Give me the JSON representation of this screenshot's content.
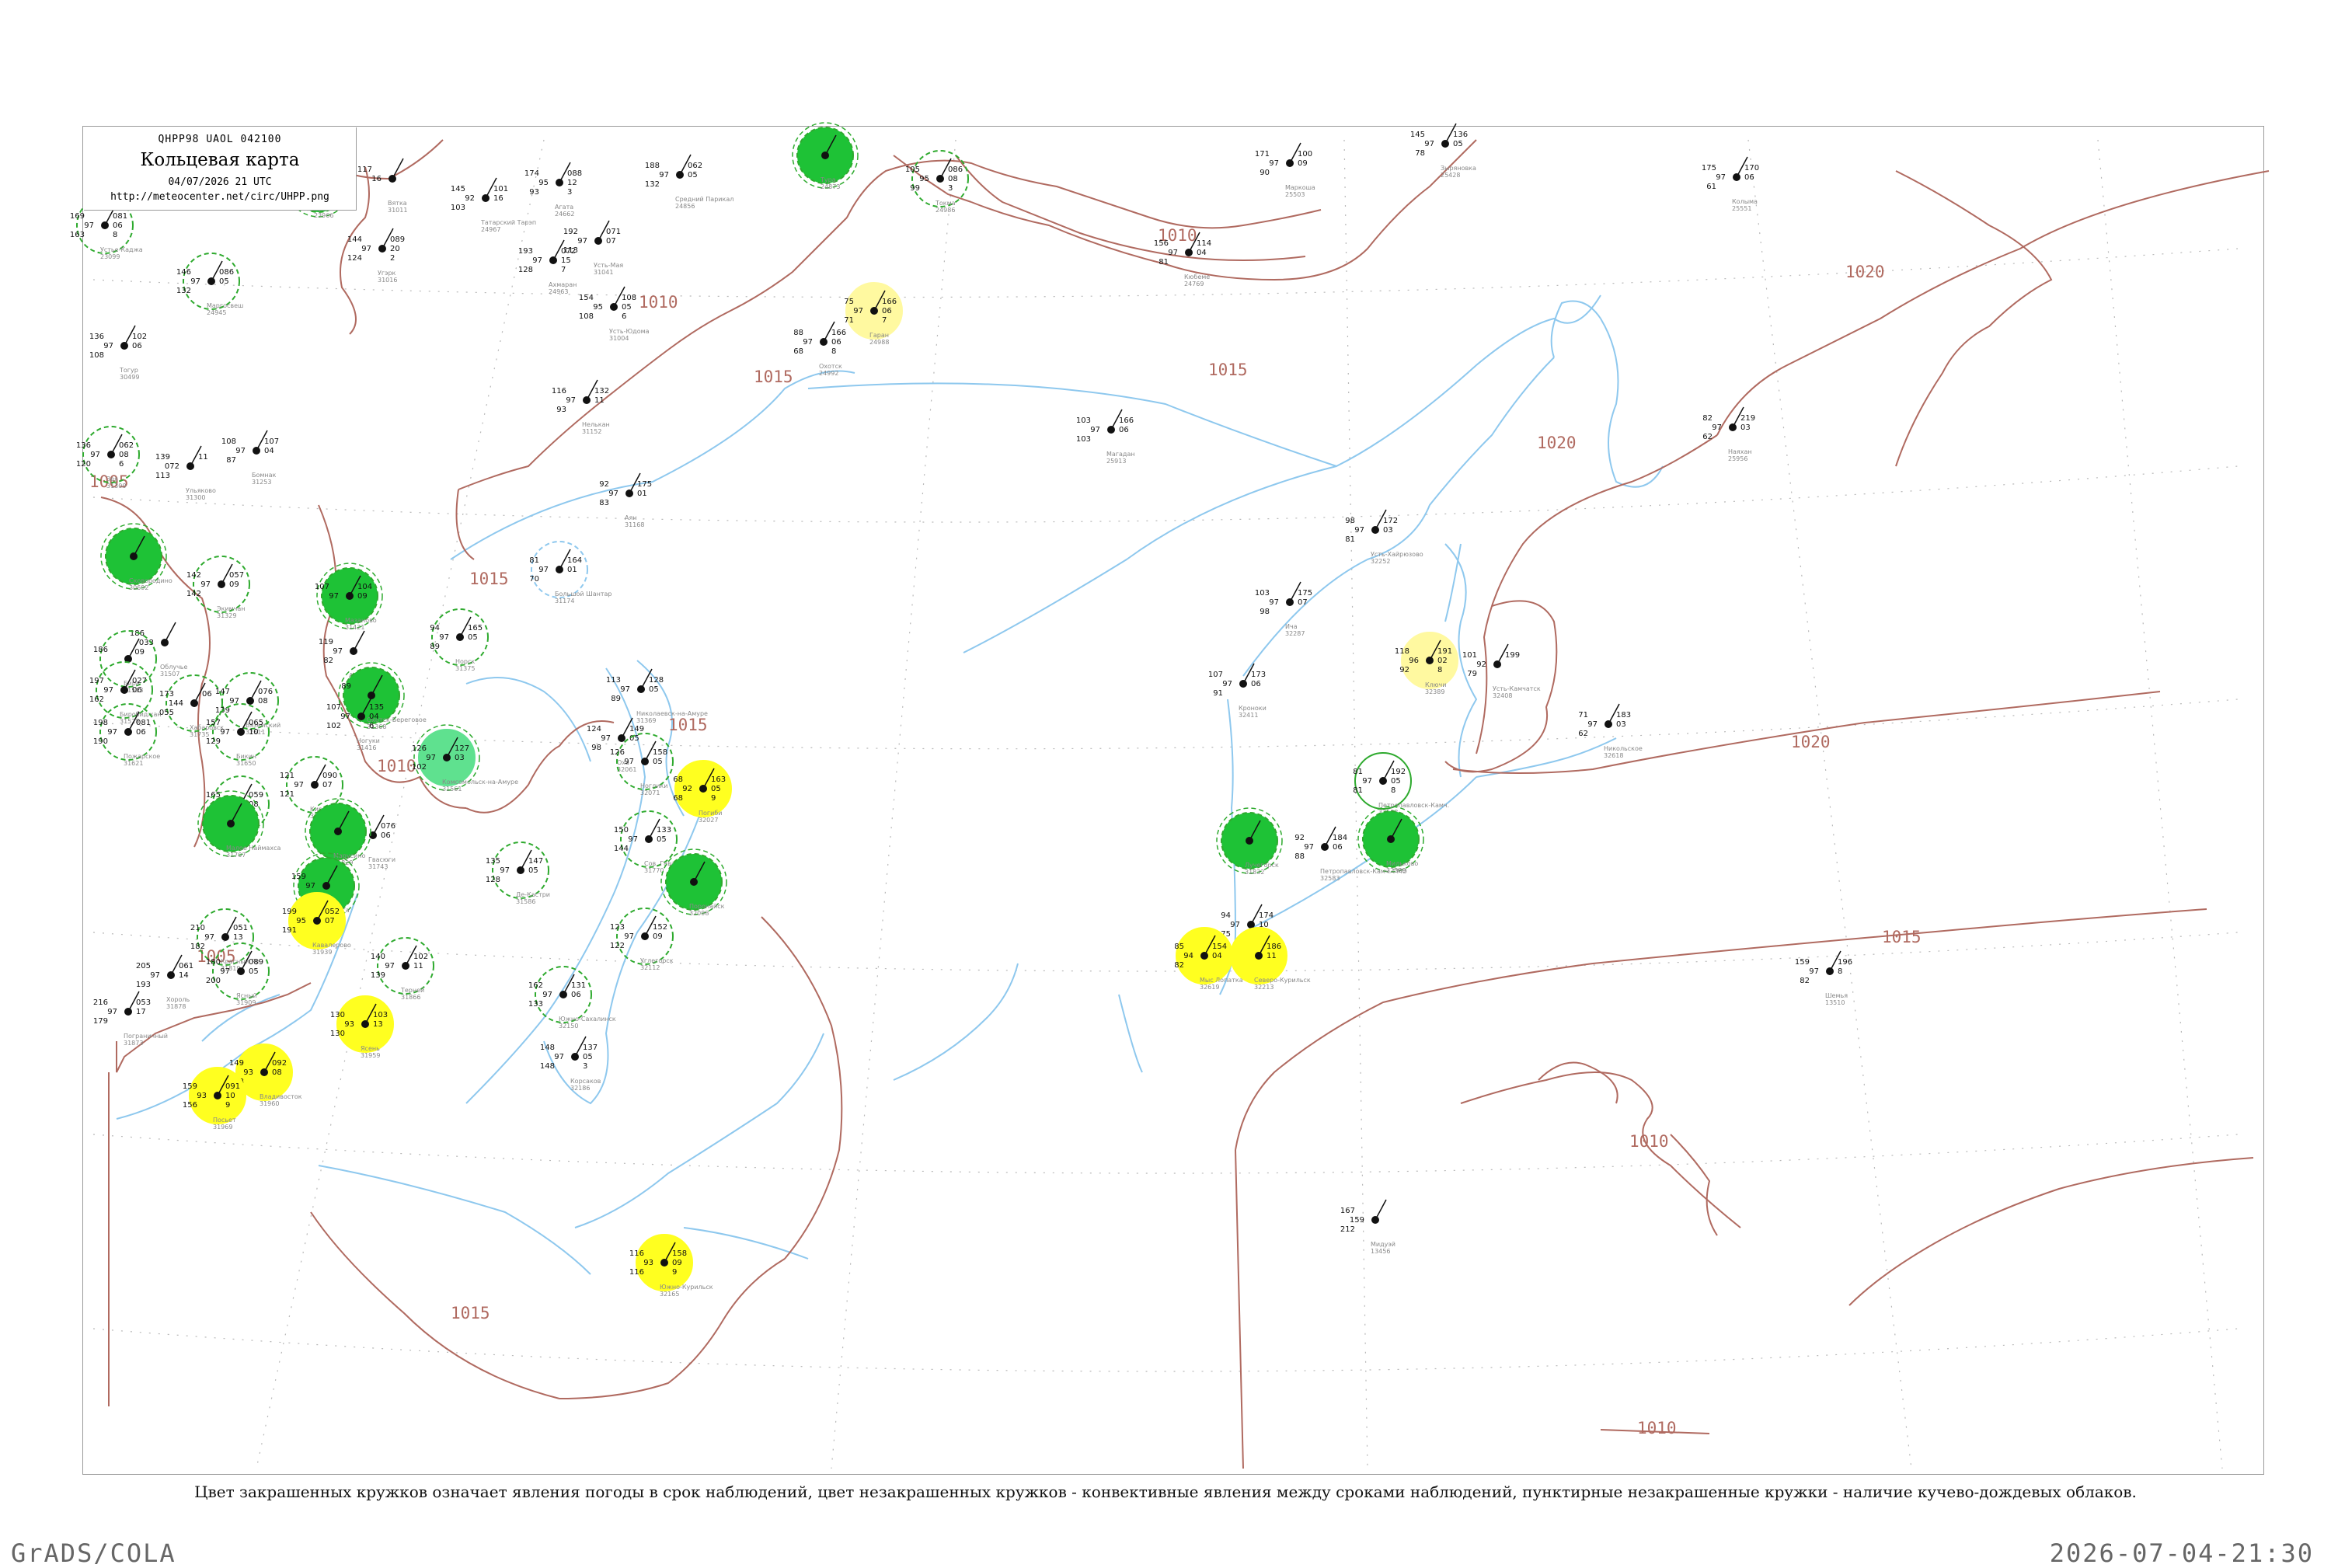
{
  "header": {
    "code": "QHPP98  UAOL  042100",
    "title": "Кольцевая карта",
    "datetime": "04/07/2026 21 UTC",
    "url": "http://meteocenter.net/circ/UHPP.png"
  },
  "caption": "Цвет закрашенных кружков означает явления погоды в срок наблюдений, цвет незакрашенных кружков - конвективные явления между сроками наблюдений, пунктирные незакрашенные кружки - наличие кучево-дождевых облаков.",
  "footer": {
    "left": "GrADS/COLA",
    "right": "2026-07-04-21:30"
  },
  "colors": {
    "isobar": "#b06a60",
    "coast": "#8ec8ee",
    "green_fill": "#1ec236",
    "light_green_fill": "#5fe18f",
    "yellow_fill": "#ffff20",
    "pale_yellow_fill": "#fff9a0",
    "ring": "#2eaa2e"
  },
  "isobar_labels": [
    "1010",
    "1015",
    "1015",
    "1010",
    "1015",
    "1015",
    "1010",
    "1005",
    "1005",
    "1015",
    "1020",
    "1020",
    "1020",
    "1015",
    "1010",
    "1010"
  ],
  "stations": [
    {
      "name": "Устье-Каджа",
      "num": "23099",
      "v": [
        "169",
        "97",
        "163",
        "081",
        "06",
        "8"
      ],
      "circle": "dashed"
    },
    {
      "name": "Бузин",
      "num": "23966",
      "v": [
        "179",
        "99",
        "126",
        "03",
        ""
      ],
      "circle": "green"
    },
    {
      "name": "Вятка",
      "num": "31011",
      "v": [
        "117",
        "16",
        "",
        ""
      ],
      "circle": "none"
    },
    {
      "name": "Татарский Тарэп",
      "num": "24967",
      "v": [
        "145",
        "92",
        "103",
        "101",
        "16"
      ],
      "circle": "none"
    },
    {
      "name": "Агата",
      "num": "24662",
      "v": [
        "174",
        "95",
        "93",
        "088",
        "12",
        "3"
      ],
      "circle": "none"
    },
    {
      "name": "Средний Парикал",
      "num": "24856",
      "v": [
        "188",
        "97",
        "132",
        "062",
        "05",
        ""
      ],
      "circle": "none"
    },
    {
      "name": "Тура",
      "num": "24873",
      "v": [
        "",
        "",
        ""
      ],
      "circle": "green"
    },
    {
      "name": "Токма",
      "num": "24986",
      "v": [
        "105",
        "95",
        "99",
        "086",
        "08",
        "3"
      ],
      "circle": "dashed"
    },
    {
      "name": "Маркоша",
      "num": "25503",
      "v": [
        "171",
        "97",
        "90",
        "100",
        "09",
        ""
      ],
      "circle": "none"
    },
    {
      "name": "Зыряновка",
      "num": "25428",
      "v": [
        "145",
        "97",
        "78",
        "136",
        "05",
        ""
      ],
      "circle": "none"
    },
    {
      "name": "Колыма",
      "num": "25551",
      "v": [
        "175",
        "97",
        "61",
        "170",
        "06",
        ""
      ],
      "circle": "none"
    },
    {
      "name": "Угэрк",
      "num": "31016",
      "v": [
        "144",
        "97",
        "124",
        "089",
        "20",
        "2"
      ],
      "circle": "none"
    },
    {
      "name": "Усть-Мая",
      "num": "31041",
      "v": [
        "192",
        "97",
        "113",
        "071",
        "07",
        ""
      ],
      "circle": "none"
    },
    {
      "name": "Ахмаран",
      "num": "24963",
      "v": [
        "193",
        "97",
        "128",
        "072",
        "15",
        "7"
      ],
      "circle": "none"
    },
    {
      "name": "Усть-Юдома",
      "num": "31004",
      "v": [
        "154",
        "95",
        "108",
        "108",
        "05",
        "6"
      ],
      "circle": "none"
    },
    {
      "name": "Маргосвеш",
      "num": "24945",
      "v": [
        "146",
        "97",
        "132",
        "086",
        "05",
        ""
      ],
      "circle": "dashed"
    },
    {
      "name": "Кюбеме",
      "num": "24769",
      "v": [
        "156",
        "97",
        "81",
        "114",
        "04",
        ""
      ],
      "circle": "none"
    },
    {
      "name": "Гаран",
      "num": "24988",
      "v": [
        "75",
        "97",
        "71",
        "166",
        "06",
        "7"
      ],
      "circle": "paleyellow"
    },
    {
      "name": "Охотск",
      "num": "24992",
      "v": [
        "88",
        "97",
        "68",
        "166",
        "06",
        "8"
      ],
      "circle": "none"
    },
    {
      "name": "Тогур",
      "num": "30499",
      "v": [
        "136",
        "97",
        "108",
        "102",
        "06",
        ""
      ],
      "circle": "none"
    },
    {
      "name": "Нелькан",
      "num": "31152",
      "v": [
        "116",
        "97",
        "93",
        "132",
        "11",
        ""
      ],
      "circle": "none"
    },
    {
      "name": "Зея",
      "num": "31300",
      "v": [
        "136",
        "97",
        "120",
        "062",
        "08",
        "6"
      ],
      "circle": "dashed"
    },
    {
      "name": "Бомнак",
      "num": "31253",
      "v": [
        "108",
        "97",
        "87",
        "107",
        "04",
        ""
      ],
      "circle": "none"
    },
    {
      "name": "Ульяково",
      "num": "31300",
      "v": [
        "139",
        "072",
        "113",
        "11"
      ],
      "circle": "none"
    },
    {
      "name": "Магадан",
      "num": "25913",
      "v": [
        "103",
        "97",
        "103",
        "166",
        "06",
        ""
      ],
      "circle": "none"
    },
    {
      "name": "Наяхан",
      "num": "25956",
      "v": [
        "82",
        "97",
        "62",
        "219",
        "03",
        ""
      ],
      "circle": "none"
    },
    {
      "name": "Аян",
      "num": "31168",
      "v": [
        "92",
        "97",
        "83",
        "175",
        "01",
        ""
      ],
      "circle": "none"
    },
    {
      "name": "Сковородино",
      "num": "30692",
      "v": [
        "",
        "",
        ""
      ],
      "circle": "green"
    },
    {
      "name": "Экимчан",
      "num": "31329",
      "v": [
        "142",
        "97",
        "142",
        "057",
        "09",
        ""
      ],
      "circle": "dashed"
    },
    {
      "name": "Мазаново",
      "num": "31421",
      "v": [
        "107",
        "97",
        "",
        "104",
        "09",
        ""
      ],
      "circle": "green"
    },
    {
      "name": "Большой Шантар",
      "num": "31174",
      "v": [
        "81",
        "97",
        "70",
        "164",
        "01",
        ""
      ],
      "circle": "dashedblue"
    },
    {
      "name": "Усть-Хайрюзово",
      "num": "32252",
      "v": [
        "98",
        "97",
        "81",
        "172",
        "03",
        ""
      ],
      "circle": "none"
    },
    {
      "name": "Ича",
      "num": "32287",
      "v": [
        "103",
        "97",
        "98",
        "175",
        "07",
        ""
      ],
      "circle": "none"
    },
    {
      "name": "Ключи",
      "num": "32389",
      "v": [
        "118",
        "96",
        "92",
        "191",
        "02",
        "8"
      ],
      "circle": "paleyellow"
    },
    {
      "name": "Усть-Камчатск",
      "num": "32408",
      "v": [
        "101",
        "92",
        "79",
        "199",
        "",
        ""
      ],
      "circle": "none"
    },
    {
      "name": "Кроноки",
      "num": "32411",
      "v": [
        "107",
        "97",
        "91",
        "173",
        "06",
        ""
      ],
      "circle": "none"
    },
    {
      "name": "Никольское",
      "num": "32618",
      "v": [
        "71",
        "97",
        "62",
        "183",
        "03",
        ""
      ],
      "circle": "none"
    },
    {
      "name": "Архара",
      "num": "31445",
      "v": [
        "119",
        "97",
        "82",
        "",
        "",
        ""
      ],
      "circle": "none"
    },
    {
      "name": "Норск",
      "num": "31375",
      "v": [
        "94",
        "97",
        "89",
        "165",
        "05",
        ""
      ],
      "circle": "dashed"
    },
    {
      "name": "Охотск-Береговое",
      "num": "31368",
      "v": [
        "89",
        "",
        "",
        "",
        "",
        ""
      ],
      "circle": "green"
    },
    {
      "name": "Облучье",
      "num": "31507",
      "v": [
        "186",
        "033",
        "09",
        ""
      ],
      "circle": "none"
    },
    {
      "name": "Бира",
      "num": "31513",
      "v": [
        "186",
        "",
        "",
        ""
      ],
      "circle": "dashed"
    },
    {
      "name": "Биробиджан",
      "num": "31528",
      "v": [
        "197",
        "97",
        "162",
        "027",
        "06",
        ""
      ],
      "circle": "dashed"
    },
    {
      "name": "Хабаровск",
      "num": "31735",
      "v": [
        "173",
        "144",
        "055",
        "06"
      ],
      "circle": "dashed"
    },
    {
      "name": "Вяземский",
      "num": "31611",
      "v": [
        "147",
        "97",
        "139",
        "076",
        "08",
        ""
      ],
      "circle": "dashed"
    },
    {
      "name": "Пожарское",
      "num": "31621",
      "v": [
        "198",
        "97",
        "190",
        "081",
        "06",
        ""
      ],
      "circle": "dashed"
    },
    {
      "name": "Бикин",
      "num": "31650",
      "v": [
        "157",
        "97",
        "129",
        "065",
        "10",
        ""
      ],
      "circle": "dashed"
    },
    {
      "name": "Ногуки",
      "num": "31416",
      "v": [
        "107",
        "97",
        "102",
        "135",
        "04",
        "6"
      ],
      "circle": "none"
    },
    {
      "name": "Николаевск-на-Амуре",
      "num": "31369",
      "v": [
        "113",
        "97",
        "89",
        "128",
        "05",
        ""
      ],
      "circle": "none"
    },
    {
      "name": "Оха",
      "num": "32061",
      "v": [
        "124",
        "97",
        "98",
        "149",
        "05",
        ""
      ],
      "circle": "none"
    },
    {
      "name": "Ноглики",
      "num": "32071",
      "v": [
        "126",
        "97",
        "",
        "158",
        "05",
        ""
      ],
      "circle": "dashed"
    },
    {
      "name": "Комсомольск-на-Амуре",
      "num": "31561",
      "v": [
        "126",
        "97",
        "102",
        "127",
        "03",
        ""
      ],
      "circle": "lightgreen"
    },
    {
      "name": "Де-Кастри",
      "num": "31586",
      "v": [
        "135",
        "97",
        "128",
        "147",
        "05",
        ""
      ],
      "circle": "dashed"
    },
    {
      "name": "Погиби",
      "num": "32027",
      "v": [
        "68",
        "92",
        "68",
        "163",
        "05",
        "9"
      ],
      "circle": "yellow"
    },
    {
      "name": "Кировский",
      "num": "31538",
      "v": [
        "121",
        "97",
        "121",
        "090",
        "07",
        ""
      ],
      "circle": "dashed"
    },
    {
      "name": "Сутур",
      "num": "31629",
      "v": [
        "165",
        "97",
        "",
        "059",
        "08",
        ""
      ],
      "circle": "dashed"
    },
    {
      "name": "Малое Наймахса",
      "num": "31707",
      "v": [
        "",
        "",
        ""
      ],
      "circle": "green"
    },
    {
      "name": "Сов. Гавань",
      "num": "31770",
      "v": [
        "150",
        "97",
        "144",
        "133",
        "05",
        ""
      ],
      "circle": "dashed"
    },
    {
      "name": "Поронайск",
      "num": "32098",
      "v": [
        "",
        "",
        ""
      ],
      "circle": "green"
    },
    {
      "name": "Лучегорск",
      "num": "31832",
      "v": [
        "",
        "",
        "",
        "",
        "",
        ""
      ],
      "circle": "green"
    },
    {
      "name": "Гвасюги",
      "num": "31743",
      "v": [
        "148",
        "97",
        "",
        "076",
        "06",
        ""
      ],
      "circle": "none"
    },
    {
      "name": "Марусино",
      "num": "31829",
      "v": [
        "",
        "",
        "",
        "",
        "",
        ""
      ],
      "circle": "green"
    },
    {
      "name": "Самарга",
      "num": "31734",
      "v": [
        "159",
        "97",
        "",
        "",
        "",
        ""
      ],
      "circle": "green"
    },
    {
      "name": "Кавалерово",
      "num": "31939",
      "v": [
        "199",
        "95",
        "191",
        "052",
        "07",
        ""
      ],
      "circle": "yellow"
    },
    {
      "name": "Красный Яр",
      "num": "31819",
      "v": [
        "210",
        "97",
        "182",
        "051",
        "13",
        ""
      ],
      "circle": "dashed"
    },
    {
      "name": "Ясный",
      "num": "31909",
      "v": [
        "180",
        "97",
        "200",
        "089",
        "05",
        ""
      ],
      "circle": "dashed"
    },
    {
      "name": "Хороль",
      "num": "31878",
      "v": [
        "205",
        "97",
        "193",
        "061",
        "14",
        ""
      ],
      "circle": "none"
    },
    {
      "name": "Пограничный",
      "num": "31873",
      "v": [
        "216",
        "97",
        "179",
        "053",
        "17",
        ""
      ],
      "circle": "none"
    },
    {
      "name": "Терней",
      "num": "31866",
      "v": [
        "140",
        "97",
        "139",
        "102",
        "11",
        ""
      ],
      "circle": "dashed"
    },
    {
      "name": "Ясень",
      "num": "31959",
      "v": [
        "130",
        "93",
        "130",
        "103",
        "13",
        ""
      ],
      "circle": "yellow"
    },
    {
      "name": "Владивосток",
      "num": "31960",
      "v": [
        "149",
        "93",
        "148",
        "092",
        "08",
        ""
      ],
      "circle": "yellow"
    },
    {
      "name": "Посьет",
      "num": "31969",
      "v": [
        "159",
        "93",
        "156",
        "091",
        "10",
        "9"
      ],
      "circle": "yellow"
    },
    {
      "name": "Южно-Сахалинск",
      "num": "32150",
      "v": [
        "162",
        "97",
        "133",
        "131",
        "06",
        ""
      ],
      "circle": "dashed"
    },
    {
      "name": "Углегорск",
      "num": "32112",
      "v": [
        "123",
        "97",
        "122",
        "152",
        "09",
        ""
      ],
      "circle": "dashed"
    },
    {
      "name": "Корсаков",
      "num": "32186",
      "v": [
        "148",
        "97",
        "148",
        "137",
        "05",
        "3"
      ],
      "circle": "none"
    },
    {
      "name": "Южно-Курильск",
      "num": "32165",
      "v": [
        "116",
        "93",
        "116",
        "158",
        "09",
        "9"
      ],
      "circle": "yellow"
    },
    {
      "name": "Петропавловск-Камч.",
      "num": "32583",
      "v": [
        "81",
        "97",
        "81",
        "192",
        "05",
        "8"
      ],
      "circle": "greenring"
    },
    {
      "name": "Мильково",
      "num": "32389",
      "v": [
        "",
        "",
        ""
      ],
      "circle": "green"
    },
    {
      "name": "Петропавловск-Камч. ГМО",
      "num": "32583",
      "v": [
        "92",
        "97",
        "88",
        "184",
        "06",
        ""
      ],
      "circle": "none"
    },
    {
      "name": "Лопатка",
      "num": "32618",
      "v": [
        "94",
        "97",
        "75",
        "174",
        "10",
        ""
      ],
      "circle": "none"
    },
    {
      "name": "Мыс Лопатка",
      "num": "32619",
      "v": [
        "85",
        "94",
        "82",
        "154",
        "04",
        ""
      ],
      "circle": "yellow"
    },
    {
      "name": "Северо-Курильск",
      "num": "32213",
      "v": [
        "",
        "",
        "",
        "186",
        "11",
        ""
      ],
      "circle": "yellow"
    },
    {
      "name": "Шемья",
      "num": "13510",
      "v": [
        "159",
        "97",
        "82",
        "196",
        "8",
        ""
      ],
      "circle": "none"
    },
    {
      "name": "Мидуэй",
      "num": "13456",
      "v": [
        "167",
        "159",
        "212"
      ],
      "circle": "none"
    }
  ]
}
